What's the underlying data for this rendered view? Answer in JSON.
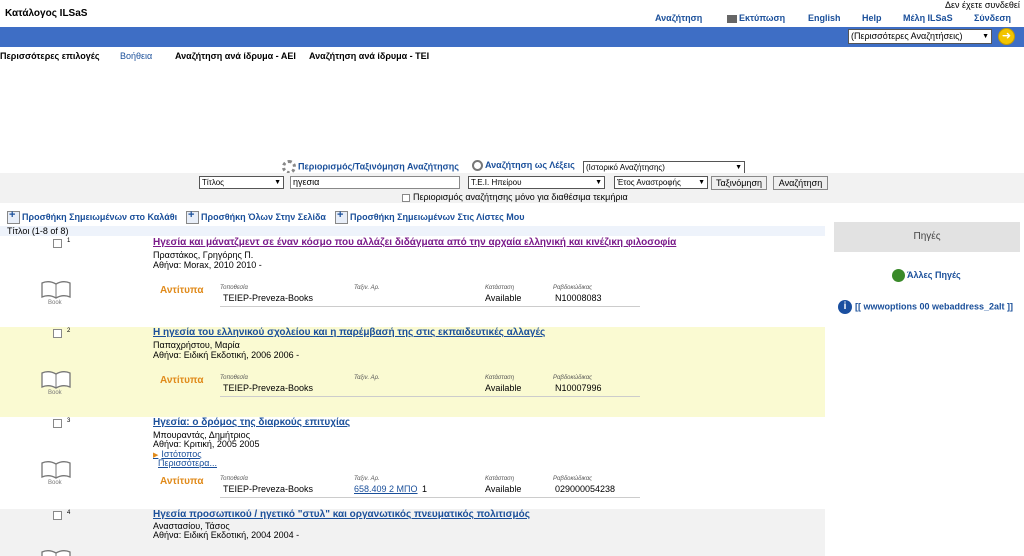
{
  "header": {
    "app_title": "Κατάλογος ILSaS",
    "login_status": "Δεν έχετε συνδεθεί",
    "nav": {
      "search": "Αναζήτηση",
      "print": "Εκτύπωση",
      "english": "English",
      "help": "Help",
      "members": "Μέλη ILSaS",
      "login": "Σύνδεση"
    },
    "more_searches_select": "(Περισσότερες Αναζητήσεις)",
    "go_icon": "arrow-right-icon"
  },
  "subnav": {
    "more_options": "Περισσότερες επιλογές",
    "help": "Βοήθεια",
    "by_institution_aei": "Αναζήτηση ανά ίδρυμα - ΑΕΙ",
    "by_institution_tei": "Αναζήτηση ανά ίδρυμα - ΤΕΙ"
  },
  "search": {
    "limit_sort_label": "Περιορισμός/Ταξινόμηση Αναζήτησης",
    "words_search_label": "Αναζήτηση ως Λέξεις",
    "history_select": "(Ιστορικό Αναζήτησης)",
    "field_select": "Τίτλος",
    "query_value": "ηγεσια",
    "library_select": "Τ.Ε.Ι. Ηπείρου",
    "sort_select": "Έτος Αναστροφής",
    "sort_button": "Ταξινόμηση",
    "search_button": "Αναζήτηση",
    "available_only_label": "Περιορισμός αναζήτησης μόνο για διαθέσιμα τεκμήρια"
  },
  "actions": {
    "add_marked_to_cart": "Προσθήκη Σημειωμένων στο Καλάθι",
    "add_all_on_page": "Προσθήκη Όλων Στην Σελίδα",
    "add_marked_to_lists": "Προσθήκη Σημειωμένων Στις Λίστες Μου"
  },
  "results_header": "Τίτλοι (1-8 of 8)",
  "holdings_headers": {
    "location": "Τοποθεσία",
    "call_number": "Ταξιν. Αρ.",
    "status": "Κατάσταση",
    "barcode": "Ραβδοκώδικας"
  },
  "copies_label": "Αντίτυπα",
  "book_label": "Book",
  "records": [
    {
      "num": "1",
      "title": "Ηγεσία και μάνατζμεντ σε έναν κόσμο που αλλάζει διδάγματα από την αρχαία ελληνική και κινέζικη φιλοσοφία",
      "author": "Πραστάκος, Γρηγόρης Π.",
      "publication": "Αθήνα: Morax, 2010 2010 -",
      "location": "TEIEP-Preveza-Books",
      "call_number": "",
      "copies_count": "",
      "status": "Available",
      "barcode": "N10008083"
    },
    {
      "num": "2",
      "title": "Η ηγεσία του ελληνικού σχολείου και η παρέμβασή της στις εκπαιδευτικές αλλαγές",
      "author": "Παπαχρήστου, Μαρία",
      "publication": "Αθήνα: Ειδική Εκδοτική, 2006 2006 -",
      "location": "TEIEP-Preveza-Books",
      "call_number": "",
      "copies_count": "",
      "status": "Available",
      "barcode": "N10007996"
    },
    {
      "num": "3",
      "title": "Ηγεσία: ο δρόμος της διαρκούς επιτυχίας",
      "author": "Μπουραντάς, Δημήτριος",
      "publication": "Αθήνα: Κριτική, 2005 2005",
      "website_link": "Ιστότοπος",
      "more_link": "Περισσότερα...",
      "location": "TEIEP-Preveza-Books",
      "call_number": "658.409 2 ΜΠΟ",
      "copies_count": "1",
      "status": "Available",
      "barcode": "029000054238"
    },
    {
      "num": "4",
      "title": "Ηγεσία προσωπικού / ηγετικό \"στυλ\" και οργανωτικός πνευματικός πολιτισμός",
      "author": "Αναστασίου, Τάσος",
      "publication": "Αθήνα: Ειδική Εκδοτική, 2004 2004 -"
    }
  ],
  "sidebar": {
    "heading": "Πηγές",
    "other_sources": "Άλλες Πηγές",
    "options_placeholder": "[[ wwwoptions 00 webaddress_2alt ]]"
  },
  "colors": {
    "nav_blue": "#3e6ec5",
    "link_blue": "#1a4f9a",
    "highlight_row": "#fafad2",
    "copies_orange": "#e08a1a"
  }
}
